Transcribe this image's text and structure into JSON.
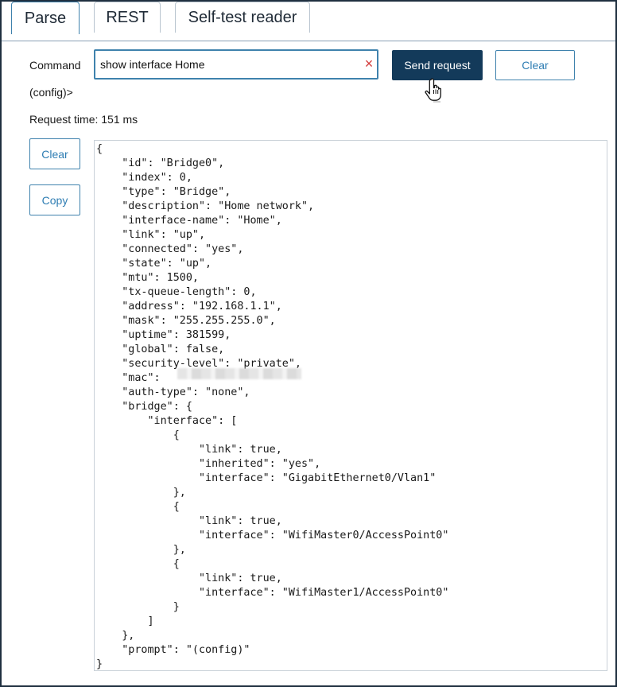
{
  "tabs": [
    {
      "label": "Parse",
      "active": true
    },
    {
      "label": "REST",
      "active": false
    },
    {
      "label": "Self-test reader",
      "active": false
    }
  ],
  "command": {
    "label": "Command",
    "value": "show interface Home",
    "clear_icon": "close-icon",
    "prompt_label": "(config)>"
  },
  "actions": {
    "send_label": "Send request",
    "clear_top_label": "Clear",
    "clear_side_label": "Clear",
    "copy_label": "Copy"
  },
  "request_time": "Request time: 151 ms",
  "output_text": "{\n    \"id\": \"Bridge0\",\n    \"index\": 0,\n    \"type\": \"Bridge\",\n    \"description\": \"Home network\",\n    \"interface-name\": \"Home\",\n    \"link\": \"up\",\n    \"connected\": \"yes\",\n    \"state\": \"up\",\n    \"mtu\": 1500,\n    \"tx-queue-length\": 0,\n    \"address\": \"192.168.1.1\",\n    \"mask\": \"255.255.255.0\",\n    \"uptime\": 381599,\n    \"global\": false,\n    \"security-level\": \"private\",\n    \"mac\": \n    \"auth-type\": \"none\",\n    \"bridge\": {\n        \"interface\": [\n            {\n                \"link\": true,\n                \"inherited\": \"yes\",\n                \"interface\": \"GigabitEthernet0/Vlan1\"\n            },\n            {\n                \"link\": true,\n                \"interface\": \"WifiMaster0/AccessPoint0\"\n            },\n            {\n                \"link\": true,\n                \"interface\": \"WifiMaster1/AccessPoint0\"\n            }\n        ]\n    },\n    \"prompt\": \"(config)\"\n}",
  "colors": {
    "primary": "#133a5a",
    "accent": "#3f82ad",
    "clear_x": "#d23a3a"
  }
}
